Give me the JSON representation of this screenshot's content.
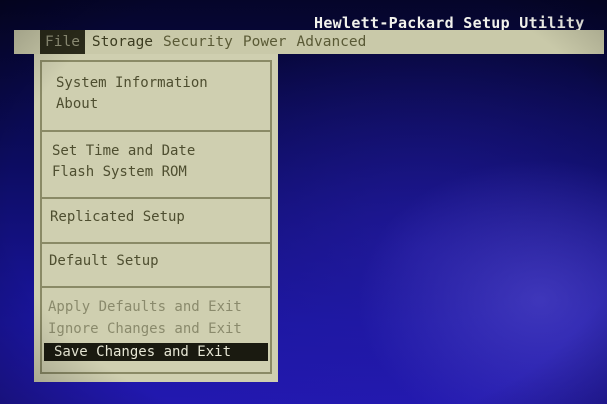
{
  "app": {
    "title": "Hewlett-Packard Setup Utility"
  },
  "menubar": {
    "items": [
      {
        "label": "File",
        "active": true
      },
      {
        "label": "Storage",
        "active": false
      },
      {
        "label": "Security",
        "active": false
      },
      {
        "label": "Power",
        "active": false
      },
      {
        "label": "Advanced",
        "active": false
      }
    ]
  },
  "file_menu": {
    "groups": [
      [
        "System Information",
        "About"
      ],
      [
        "Set Time and Date",
        "Flash System ROM"
      ],
      [
        "Replicated Setup"
      ],
      [
        "Default Setup"
      ],
      [
        "Apply Defaults and Exit",
        "Ignore Changes and Exit",
        "Save Changes and Exit"
      ]
    ],
    "selected": "Save Changes and Exit"
  },
  "colors": {
    "menubar_bg": "#c9c9a9",
    "menu_text": "#5a5a36",
    "highlight_bg": "#1a1a10",
    "highlight_text": "#e6e6d4",
    "screen_blue": "#1a15a0"
  }
}
